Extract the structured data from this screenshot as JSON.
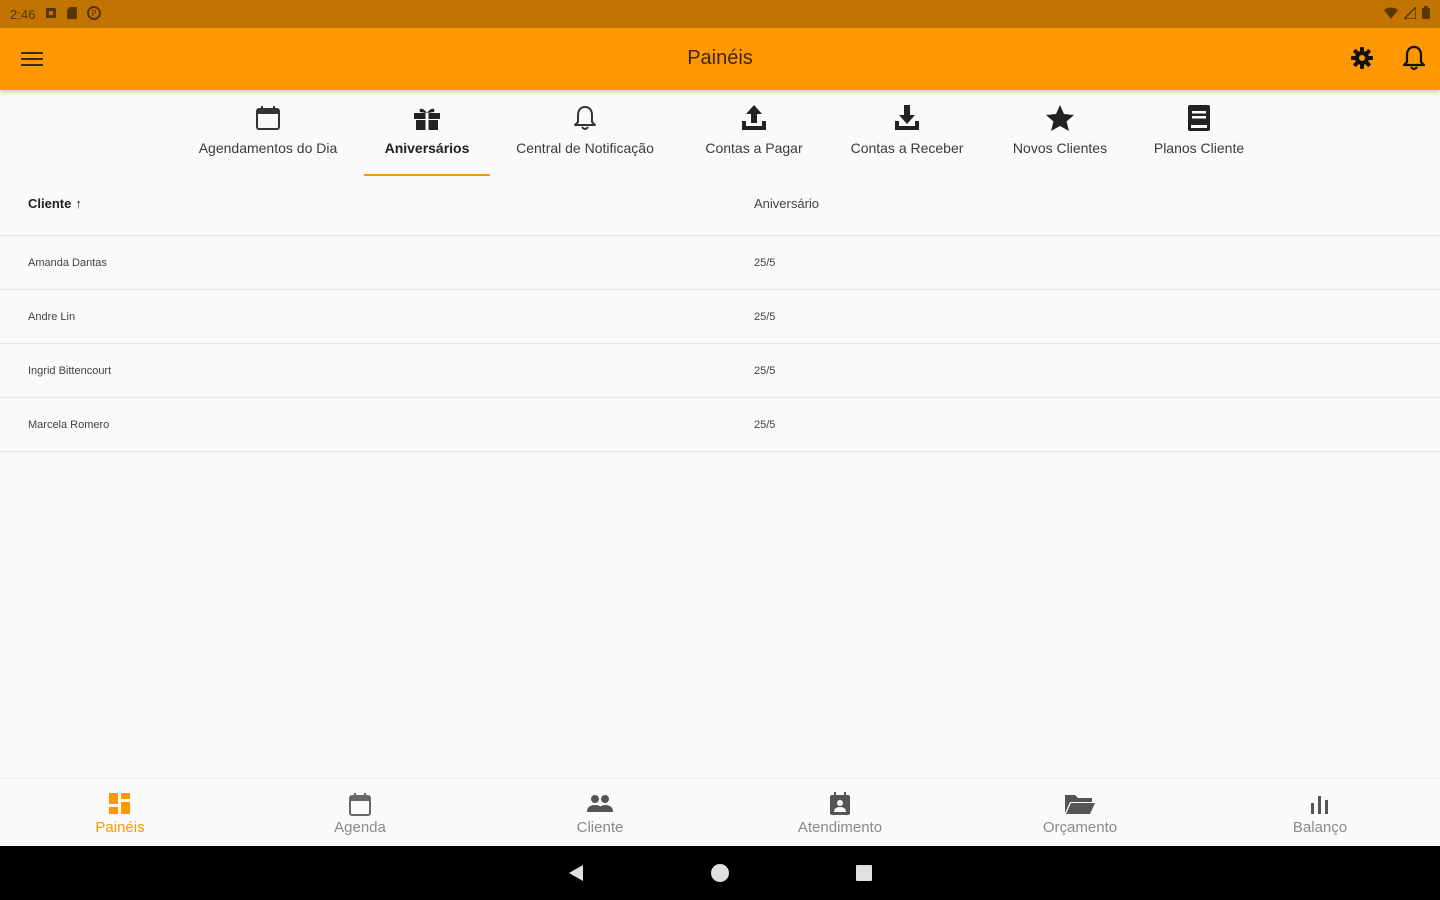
{
  "status_bar": {
    "time": "2:46"
  },
  "app_bar": {
    "title": "Painéis"
  },
  "tabs": [
    {
      "label": "Agendamentos do Dia",
      "icon": "calendar-icon"
    },
    {
      "label": "Aniversários",
      "icon": "gift-icon",
      "active": true
    },
    {
      "label": "Central de Notificação",
      "icon": "bell-outline-icon"
    },
    {
      "label": "Contas a Pagar",
      "icon": "upload-icon"
    },
    {
      "label": "Contas a Receber",
      "icon": "download-icon"
    },
    {
      "label": "Novos Clientes",
      "icon": "star-icon"
    },
    {
      "label": "Planos Cliente",
      "icon": "book-icon"
    }
  ],
  "table": {
    "columns": {
      "client": "Cliente",
      "birthday": "Aniversário"
    },
    "sort_indicator": "↑",
    "rows": [
      {
        "name": "Amanda Dantas",
        "date": "25/5"
      },
      {
        "name": "Andre Lin",
        "date": "25/5"
      },
      {
        "name": "Ingrid Bittencourt",
        "date": "25/5"
      },
      {
        "name": "Marcela Romero",
        "date": "25/5"
      }
    ]
  },
  "bottom_nav": [
    {
      "label": "Painéis",
      "icon": "dashboard-icon",
      "active": true
    },
    {
      "label": "Agenda",
      "icon": "calendar-icon"
    },
    {
      "label": "Cliente",
      "icon": "people-icon"
    },
    {
      "label": "Atendimento",
      "icon": "contact-card-icon"
    },
    {
      "label": "Orçamento",
      "icon": "folder-open-icon"
    },
    {
      "label": "Balanço",
      "icon": "bar-chart-icon"
    }
  ],
  "colors": {
    "accent": "#ff9800",
    "status_bar": "#c27400",
    "background": "#fafafa"
  }
}
